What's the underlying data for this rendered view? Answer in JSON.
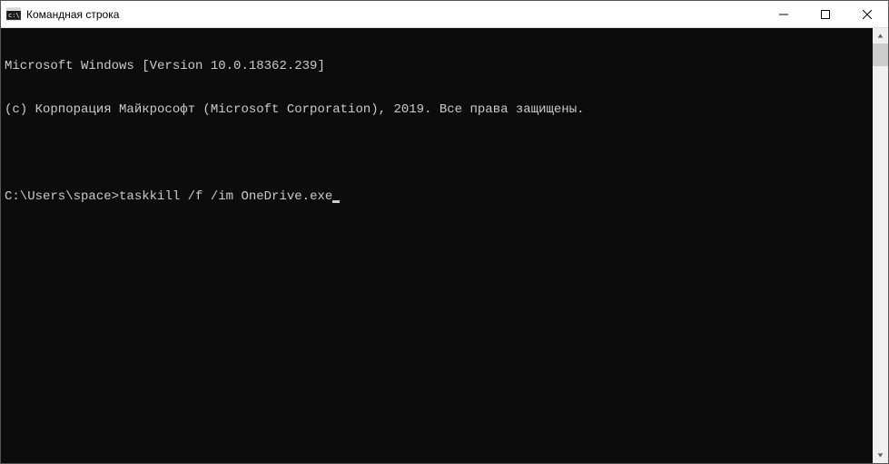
{
  "window": {
    "title": "Командная строка"
  },
  "terminal": {
    "line1": "Microsoft Windows [Version 10.0.18362.239]",
    "line2": "(c) Корпорация Майкрософт (Microsoft Corporation), 2019. Все права защищены.",
    "prompt": "C:\\Users\\space>",
    "command": "taskkill /f /im OneDrive.exe"
  }
}
